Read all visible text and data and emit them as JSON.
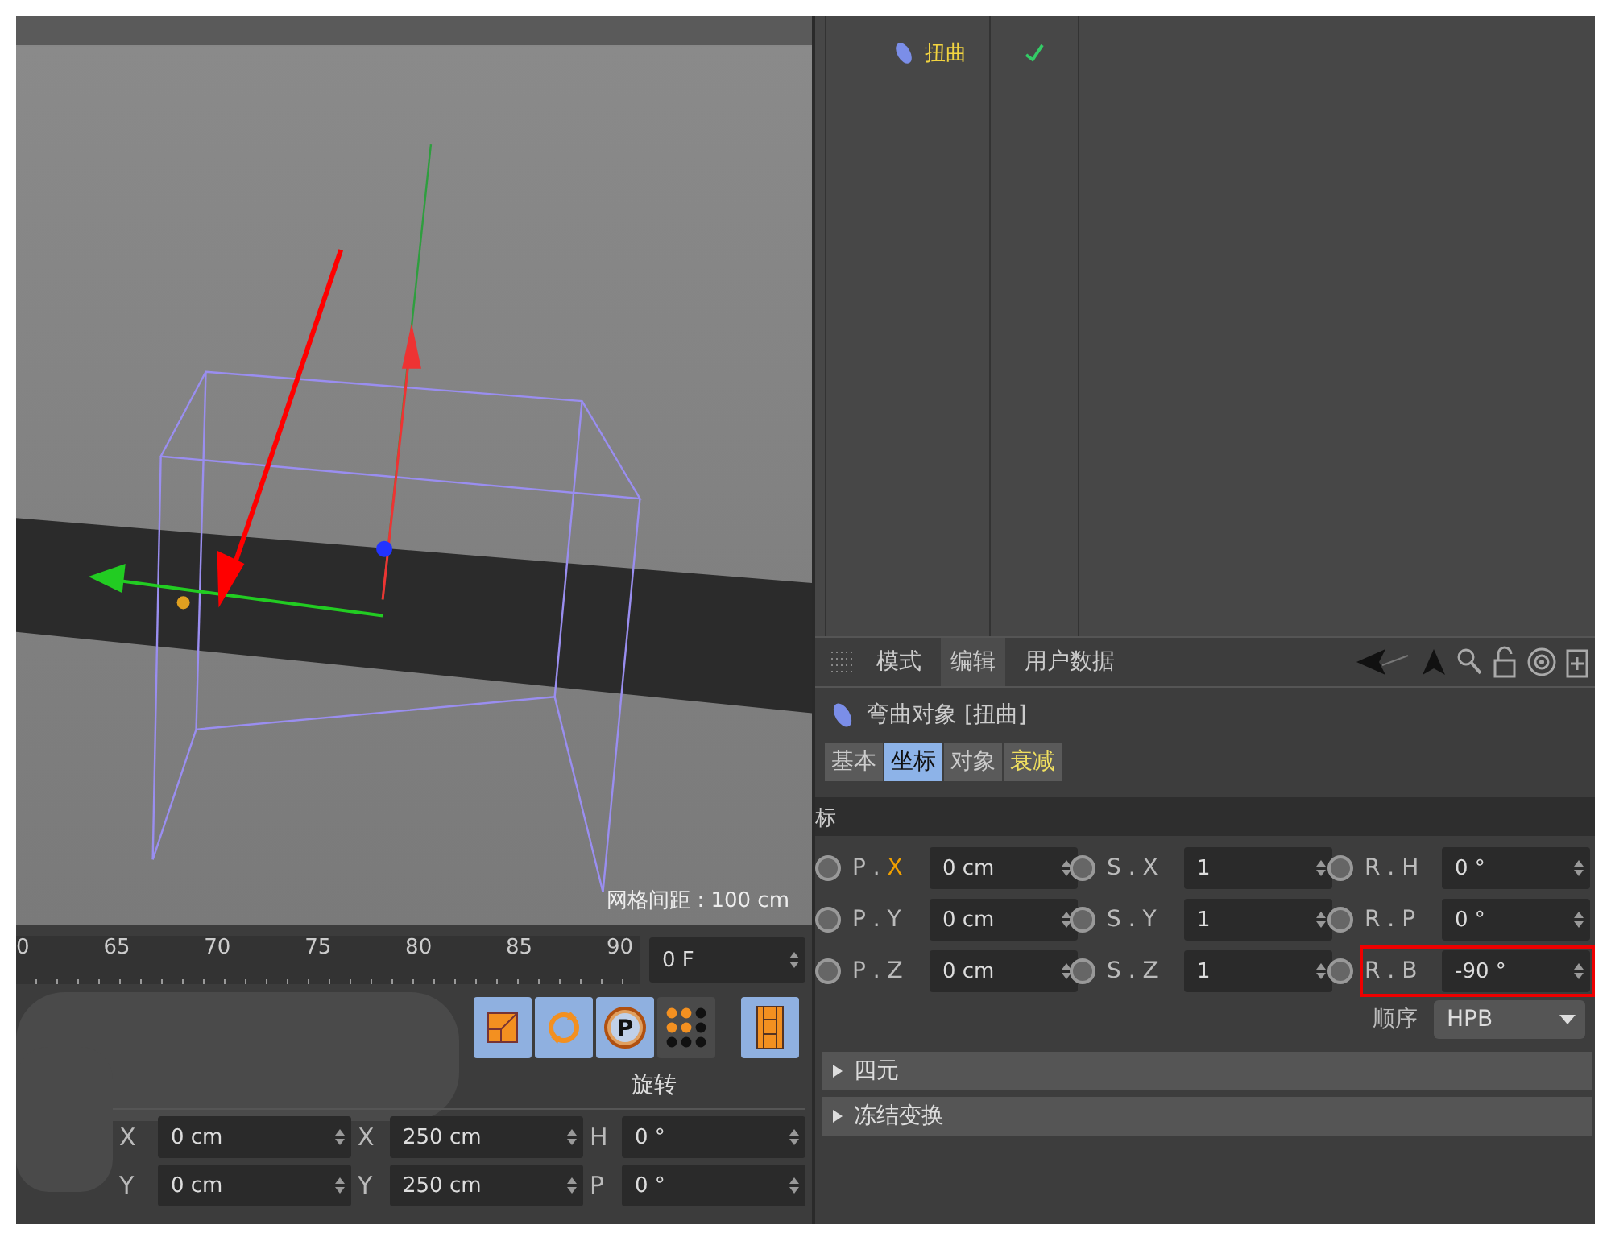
{
  "viewport": {
    "grid_label": "网格间距 : 100 cm"
  },
  "timeline": {
    "ticks": [
      "0",
      "65",
      "70",
      "75",
      "80",
      "85",
      "90"
    ],
    "frame_field": "0 F"
  },
  "toolbar": {
    "buttons": [
      {
        "kind": "scale",
        "selected": true
      },
      {
        "kind": "rotate",
        "selected": true
      },
      {
        "kind": "param",
        "selected": true,
        "label": "P"
      },
      {
        "kind": "dots",
        "selected": false
      },
      {
        "kind": "film",
        "selected": true
      }
    ]
  },
  "coordinates": {
    "header": "旋转",
    "rows": [
      [
        {
          "label": "X",
          "value": "0 cm"
        },
        {
          "label": "X",
          "value": "250 cm"
        },
        {
          "label": "H",
          "value": "0 °"
        }
      ],
      [
        {
          "label": "Y",
          "value": "0 cm"
        },
        {
          "label": "Y",
          "value": "250 cm"
        },
        {
          "label": "P",
          "value": "0 °"
        }
      ]
    ]
  },
  "object_manager": {
    "objects": [
      {
        "name": "扭曲",
        "enabled": true
      }
    ]
  },
  "attributes": {
    "tabs": [
      {
        "label": "模式",
        "selected": false
      },
      {
        "label": "编辑",
        "selected": true
      },
      {
        "label": "用户数据",
        "selected": false
      }
    ],
    "object_title": "弯曲对象 [扭曲]",
    "subtabs": [
      {
        "label": "基本",
        "selected": false,
        "highlighted": false
      },
      {
        "label": "坐标",
        "selected": true,
        "highlighted": false
      },
      {
        "label": "对象",
        "selected": false,
        "highlighted": false
      },
      {
        "label": "衰减",
        "selected": false,
        "highlighted": true
      }
    ],
    "section": "标",
    "fields": [
      [
        {
          "prefix": "P .",
          "axis": "X",
          "axis_active": true,
          "value": "0 cm",
          "marked": false,
          "animated": false
        },
        {
          "prefix": "S .",
          "axis": "X",
          "axis_active": false,
          "value": "1",
          "marked": false,
          "animated": false
        },
        {
          "prefix": "R .",
          "axis": "H",
          "axis_active": false,
          "value": "0 °",
          "marked": false,
          "animated": false
        }
      ],
      [
        {
          "prefix": "P .",
          "axis": "Y",
          "axis_active": false,
          "value": "0 cm",
          "marked": false,
          "animated": false
        },
        {
          "prefix": "S .",
          "axis": "Y",
          "axis_active": false,
          "value": "1",
          "marked": false,
          "animated": false
        },
        {
          "prefix": "R .",
          "axis": "P",
          "axis_active": false,
          "value": "0 °",
          "marked": false,
          "animated": false
        }
      ],
      [
        {
          "prefix": "P .",
          "axis": "Z",
          "axis_active": false,
          "value": "0 cm",
          "marked": false,
          "animated": false
        },
        {
          "prefix": "S .",
          "axis": "Z",
          "axis_active": false,
          "value": "1",
          "marked": false,
          "animated": false
        },
        {
          "prefix": "R .",
          "axis": "B",
          "axis_active": false,
          "value": "-90 °",
          "marked": true,
          "animated": false
        }
      ]
    ],
    "order_label": "顺序",
    "order_value": "HPB",
    "groups": [
      {
        "label": "四元",
        "expanded": false
      },
      {
        "label": "冻结变换",
        "expanded": false
      }
    ]
  }
}
